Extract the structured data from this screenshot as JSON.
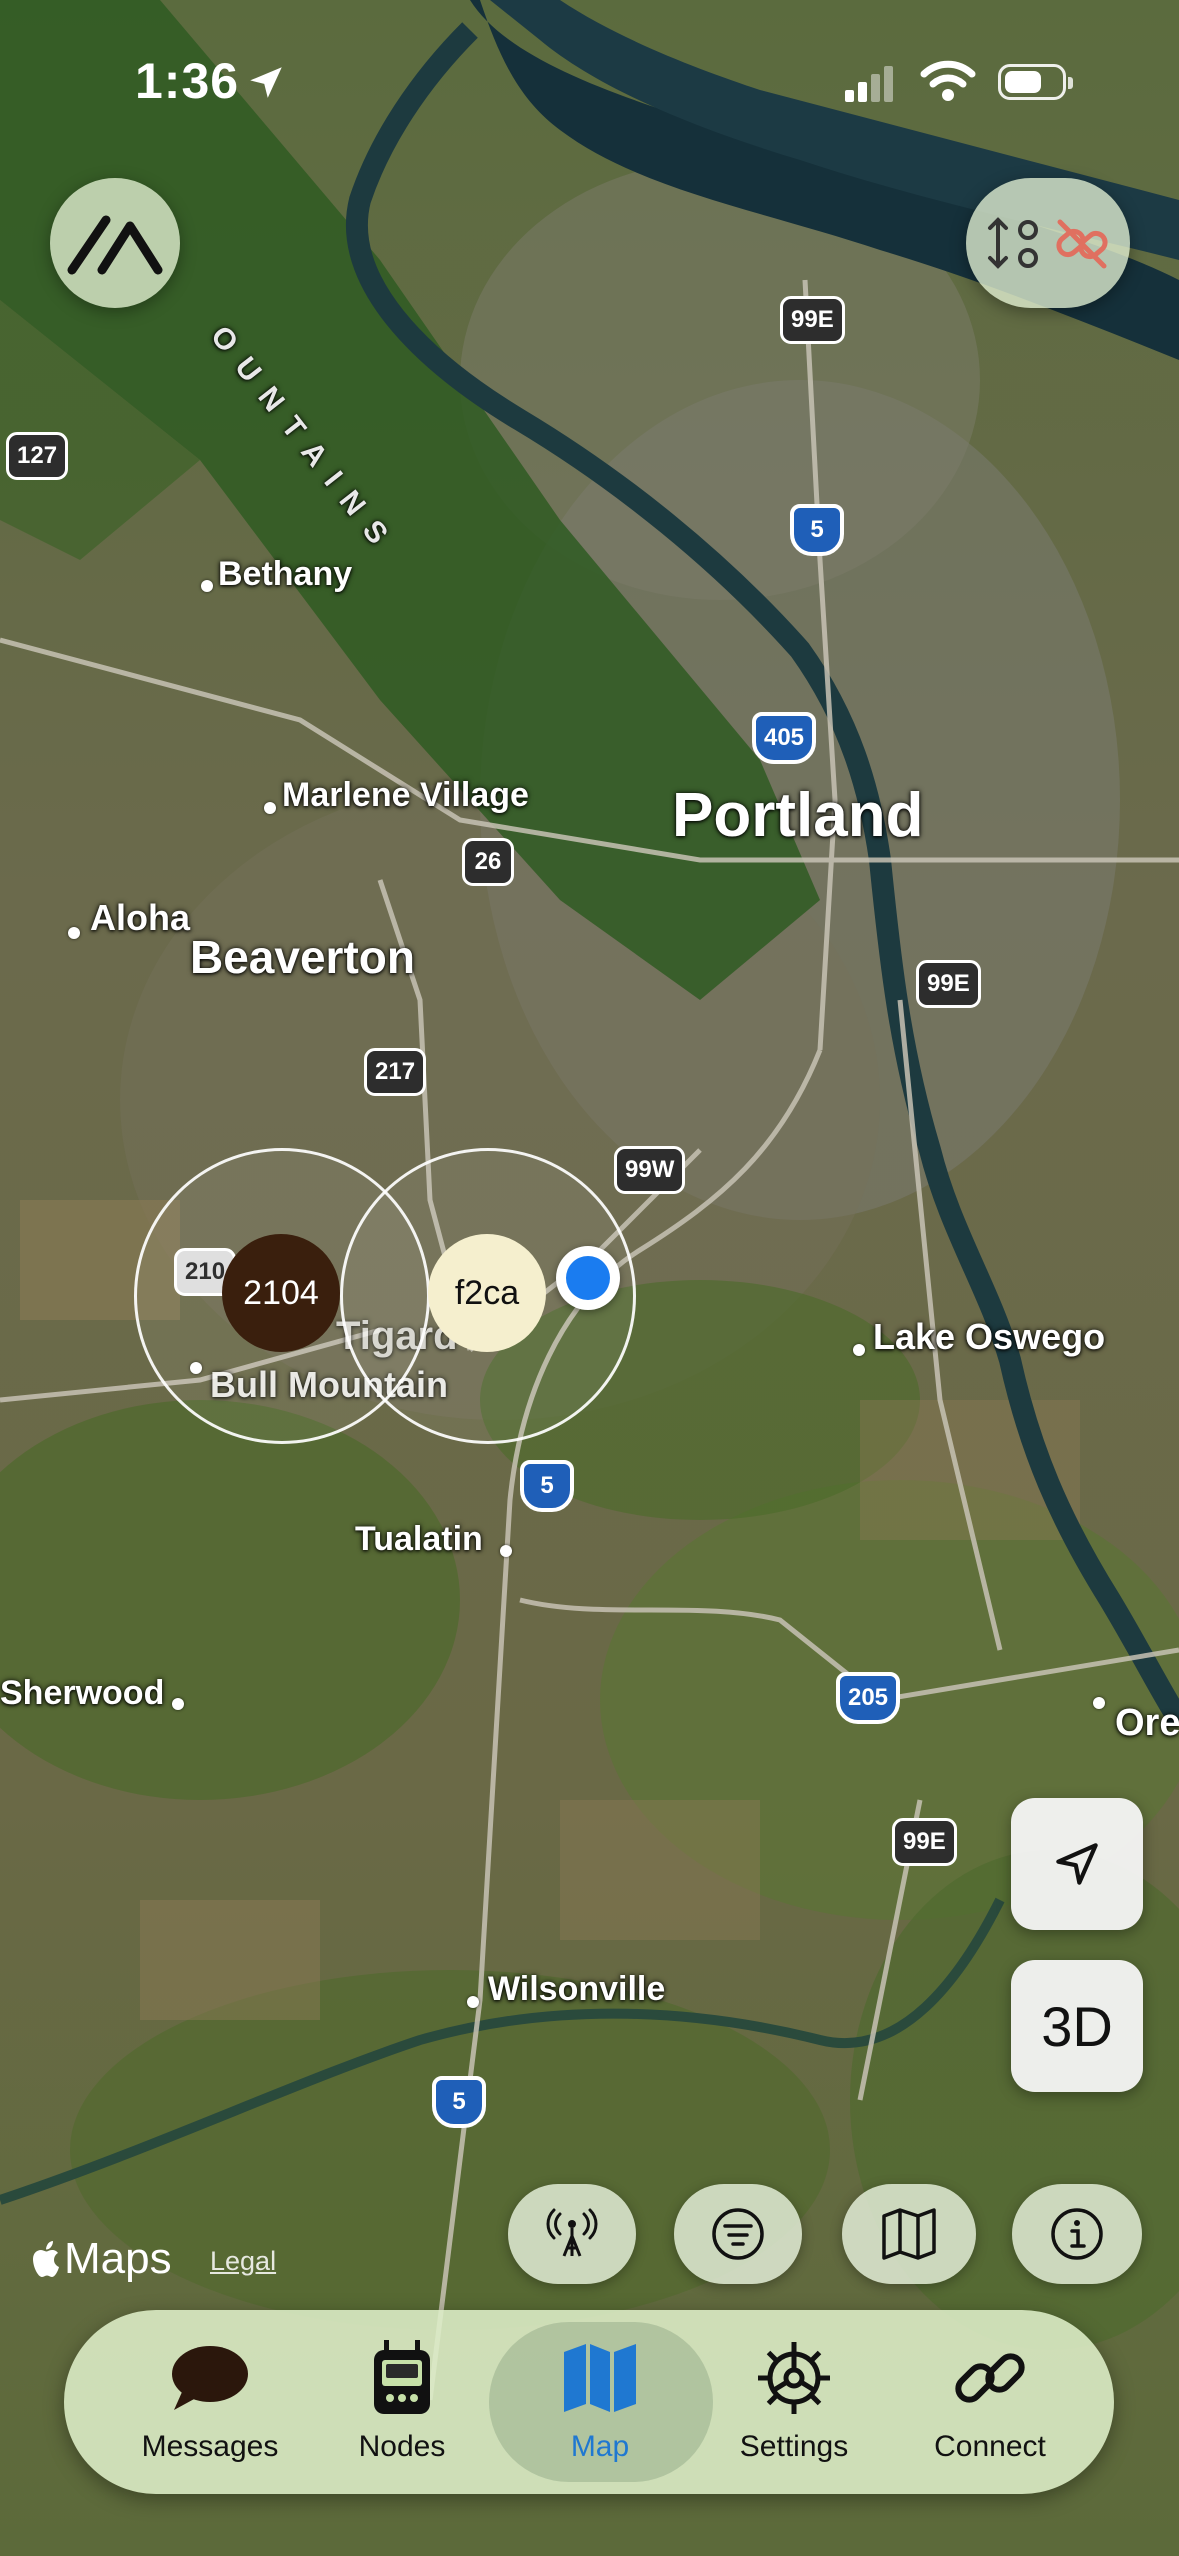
{
  "status_bar": {
    "time": "1:36"
  },
  "map": {
    "place_labels": {
      "portland": "Portland",
      "beaverton": "Beaverton",
      "bethany": "Bethany",
      "marlene_village": "Marlene Village",
      "aloha": "Aloha",
      "tigard": "Tigard",
      "bull_mountain": "Bull Mountain",
      "tualatin": "Tualatin",
      "sherwood": "Sherwood",
      "lake_oswego": "Lake Oswego",
      "wilsonville": "Wilsonville",
      "ore": "Ore",
      "mountains": "OUNTAINS"
    },
    "route_shields": {
      "r99e_a": "99E",
      "r99e_b": "99E",
      "r99e_c": "99E",
      "r127": "127",
      "r26": "26",
      "r217": "217",
      "r99w": "99W",
      "r210": "210",
      "i5_a": "5",
      "i5_b": "5",
      "i5_c": "5",
      "i405": "405",
      "i205": "205"
    },
    "nodes": {
      "node_1": {
        "label": "2104",
        "color": "#3a1f0d"
      },
      "node_2": {
        "label": "f2ca",
        "color": "#f5efce"
      }
    },
    "controls": {
      "three_d_label": "3D"
    },
    "attribution": {
      "provider": "Maps",
      "legal": "Legal"
    }
  },
  "tab_bar": {
    "selected": "map",
    "accent_color": "#1f78d1",
    "tabs": [
      {
        "id": "messages",
        "label": "Messages",
        "icon": "message-bubble-icon"
      },
      {
        "id": "nodes",
        "label": "Nodes",
        "icon": "radio-device-icon"
      },
      {
        "id": "map",
        "label": "Map",
        "icon": "map-icon"
      },
      {
        "id": "settings",
        "label": "Settings",
        "icon": "gear-icon"
      },
      {
        "id": "connect",
        "label": "Connect",
        "icon": "link-icon"
      }
    ]
  }
}
